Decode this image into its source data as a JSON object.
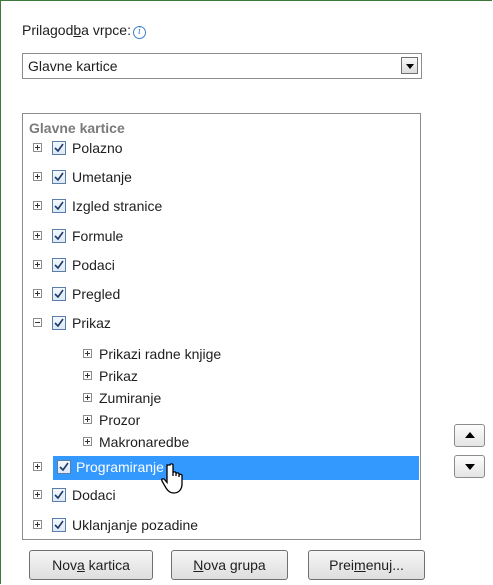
{
  "ribbon": {
    "label": "Prilagodba vrpce:",
    "label_parts": [
      "Prilagod",
      "b",
      "a vrpce:"
    ],
    "selected": "Glavne kartice"
  },
  "tree": {
    "header": "Glavne kartice",
    "items": [
      {
        "label": "Polazno",
        "checked": true,
        "expanded": false
      },
      {
        "label": "Umetanje",
        "checked": true,
        "expanded": false
      },
      {
        "label": "Izgled stranice",
        "checked": true,
        "expanded": false
      },
      {
        "label": "Formule",
        "checked": true,
        "expanded": false
      },
      {
        "label": "Podaci",
        "checked": true,
        "expanded": false
      },
      {
        "label": "Pregled",
        "checked": true,
        "expanded": false
      },
      {
        "label": "Prikaz",
        "checked": true,
        "expanded": true
      },
      {
        "label": "Programiranje",
        "checked": true,
        "expanded": false,
        "selected": true
      },
      {
        "label": "Dodaci",
        "checked": true,
        "expanded": false
      },
      {
        "label": "Uklanjanje pozadine",
        "checked": true,
        "expanded": false
      }
    ],
    "prikaz_groups": [
      "Prikazi radne knjige",
      "Prikaz",
      "Zumiranje",
      "Prozor",
      "Makronaredbe"
    ]
  },
  "buttons": {
    "new_tab": [
      "Nov",
      "a",
      " kartica"
    ],
    "new_group": [
      "",
      "N",
      "ova grupa"
    ],
    "rename": [
      "Prei",
      "m",
      "enuj..."
    ]
  },
  "colors": {
    "selection": "#3399ff",
    "frame": "#3c7a3c"
  }
}
